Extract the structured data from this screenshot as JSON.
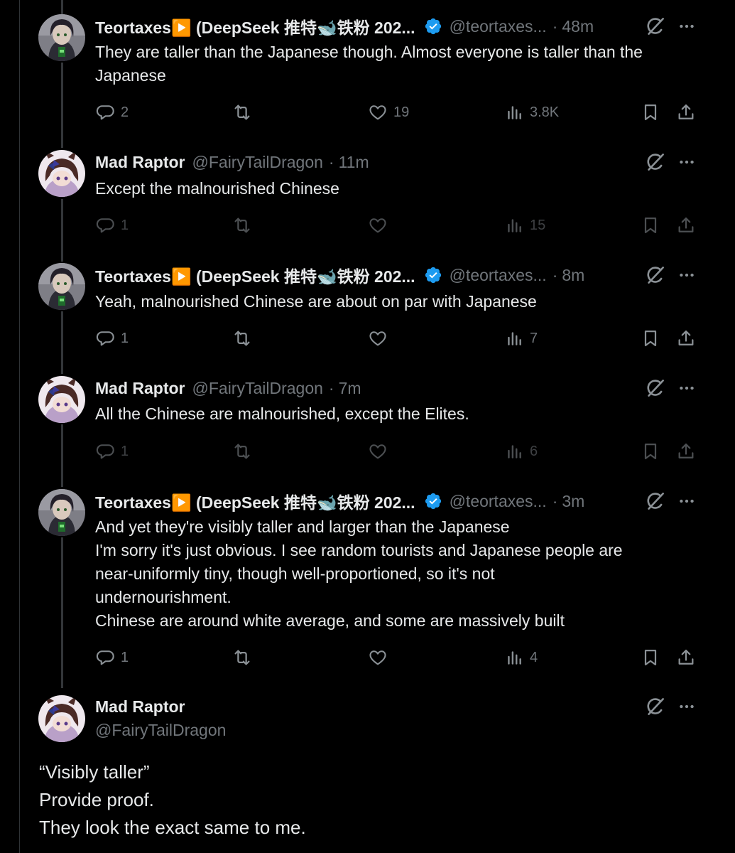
{
  "tweets": [
    {
      "name": "Teortaxes▶️ (DeepSeek 推特🐋铁粉 202...",
      "handle": "@teortaxes...",
      "time": "48m",
      "text": [
        "They are taller than the Japanese though. Almost everyone is taller than the",
        "Japanese"
      ],
      "replies": "2",
      "likes": "19",
      "views": "3.8K"
    },
    {
      "name": "Mad Raptor",
      "handle": "@FairyTailDragon",
      "time": "11m",
      "text": [
        "Except the malnourished Chinese"
      ],
      "replies": "1",
      "likes": "",
      "views": "15"
    },
    {
      "name": "Teortaxes▶️ (DeepSeek 推特🐋铁粉 202...",
      "handle": "@teortaxes...",
      "time": "8m",
      "text": [
        "Yeah, malnourished Chinese are about on par with Japanese"
      ],
      "replies": "1",
      "likes": "",
      "views": "7"
    },
    {
      "name": "Mad Raptor",
      "handle": "@FairyTailDragon",
      "time": "7m",
      "text": [
        "All the Chinese are malnourished, except the Elites."
      ],
      "replies": "1",
      "likes": "",
      "views": "6"
    },
    {
      "name": "Teortaxes▶️ (DeepSeek 推特🐋铁粉 202...",
      "handle": "@teortaxes...",
      "time": "3m",
      "text": [
        "And yet they're visibly taller and larger than the Japanese",
        "I'm sorry it's just obvious. I see random tourists and Japanese people are",
        "near-uniformly tiny, though well-proportioned, so it's not",
        "undernourishment.",
        "Chinese are around white average, and some are massively built"
      ],
      "replies": "1",
      "likes": "",
      "views": "4"
    }
  ],
  "main_tweet": {
    "name": "Mad Raptor",
    "handle": "@FairyTailDragon",
    "text": [
      "“Visibly taller”",
      "Provide proof.",
      "They look the exact same to me."
    ]
  },
  "separator": "·",
  "colors": {
    "background": "#000000",
    "text": "#e7e9ea",
    "muted": "#71767b",
    "verified": "#1d9bf0",
    "thread_line": "#333639"
  },
  "icons": [
    "verified-badge-icon",
    "grok-icon",
    "more-icon",
    "reply-icon",
    "retweet-icon",
    "like-icon",
    "views-icon",
    "bookmark-icon",
    "share-icon"
  ]
}
